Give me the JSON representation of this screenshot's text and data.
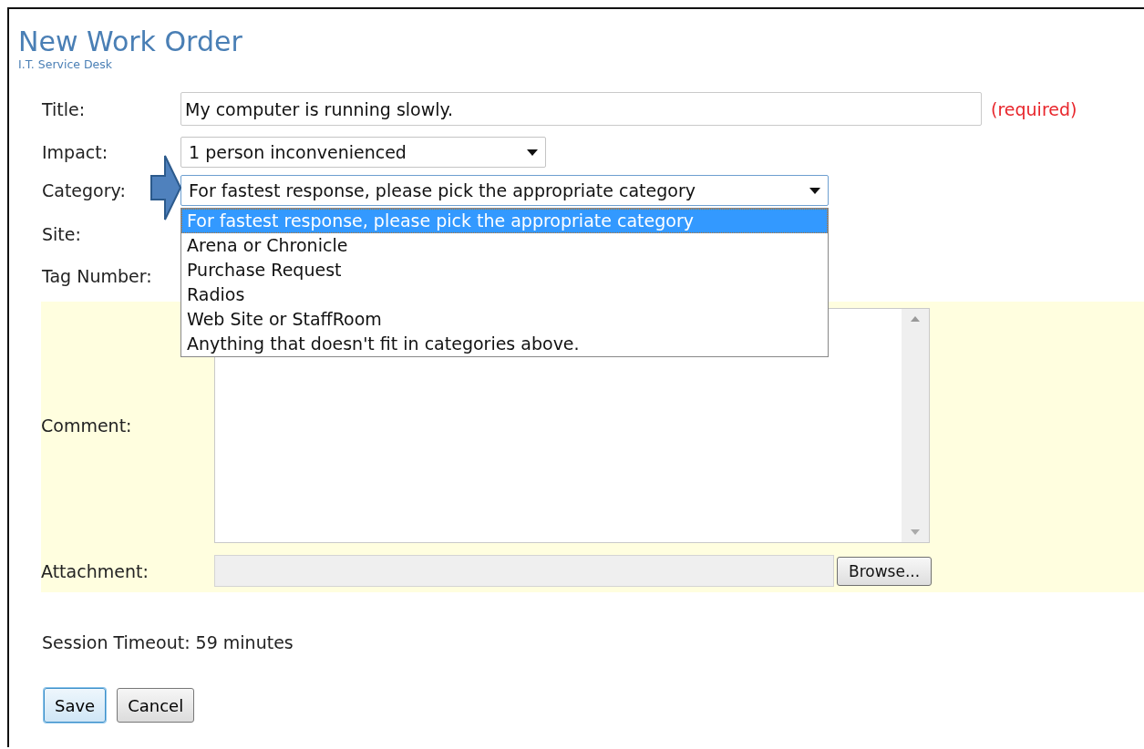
{
  "header": {
    "title": "New Work Order",
    "subtitle": "I.T. Service Desk"
  },
  "fields": [
    {
      "kind": "text",
      "label": "Title:",
      "value": "My computer is running slowly.",
      "note": "(required)"
    },
    {
      "kind": "select",
      "label": "Impact:",
      "value": "1 person inconvenienced",
      "expanded": false
    },
    {
      "kind": "select",
      "label": "Category:",
      "value": "For fastest response, please pick the appropriate category",
      "expanded": true,
      "options": [
        {
          "label": "For fastest response, please pick the appropriate category",
          "selected": true
        },
        {
          "label": "Arena or Chronicle",
          "selected": false
        },
        {
          "label": "Purchase Request",
          "selected": false
        },
        {
          "label": "Radios",
          "selected": false
        },
        {
          "label": "Web Site or StaffRoom",
          "selected": false
        },
        {
          "label": "Anything that doesn't fit in categories above.",
          "selected": false
        }
      ]
    },
    {
      "kind": "covered",
      "label": "Site:"
    },
    {
      "kind": "covered",
      "label": "Tag Number:"
    }
  ],
  "comment": {
    "label": "Comment:"
  },
  "attachment": {
    "label": "Attachment:",
    "button": "Browse..."
  },
  "session": "Session Timeout: 59 minutes",
  "buttons": [
    {
      "label": "Save",
      "focused": true
    },
    {
      "label": "Cancel",
      "focused": false
    }
  ]
}
